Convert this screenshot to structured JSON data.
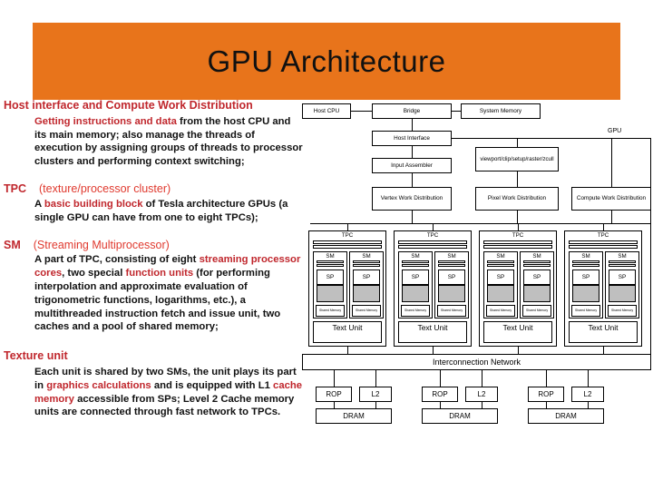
{
  "title": {
    "text": "GPU Architecture",
    "banner_color": "#E8741B"
  },
  "colors": {
    "accent_red": "#C0272D",
    "accent_red_light": "#D13A2A",
    "banner": "#E8741B",
    "gray_block": "#BFBFBF"
  },
  "left_column": {
    "sections": [
      {
        "heading": "Host interface and Compute Work Distribution",
        "heading_suffix": "",
        "body_runs": [
          {
            "t": "Getting instructions and data",
            "red": true
          },
          {
            "t": " from the host CPU and its main memory; also manage the threads of execution by assigning groups of threads to processor clusters and performing context switching;",
            "red": false
          }
        ]
      },
      {
        "heading": "TPC",
        "heading_suffix": "(texture/processor cluster)",
        "body_runs": [
          {
            "t": "A ",
            "red": false
          },
          {
            "t": "basic building block",
            "red": true
          },
          {
            "t": " of Tesla architecture GPUs (a single GPU can have from one to eight TPCs);",
            "red": false
          }
        ]
      },
      {
        "heading": "SM",
        "heading_suffix": "(Streaming Multiprocessor)",
        "body_runs": [
          {
            "t": "A part of TPC, consisting of eight ",
            "red": false
          },
          {
            "t": "streaming processor cores",
            "red": true
          },
          {
            "t": ", two special ",
            "red": false
          },
          {
            "t": "function units",
            "red": true
          },
          {
            "t": " (for performing interpolation and approximate evaluation of trigonometric functions, logarithms, etc.), a multithreaded instruction fetch and issue unit, two caches and a pool of shared memory;",
            "red": false
          }
        ]
      },
      {
        "heading": "Texture unit",
        "heading_suffix": "",
        "body_runs": [
          {
            "t": "Each unit is shared by two SMs, the unit plays its part in ",
            "red": false
          },
          {
            "t": "graphics calculations",
            "red": true
          },
          {
            "t": " and is equipped with L1 ",
            "red": false
          },
          {
            "t": "cache memory",
            "red": true
          },
          {
            "t": " accessible from SPs; Level 2 Cache memory units  are  connected through fast network to TPCs.",
            "red": false
          }
        ]
      }
    ]
  },
  "diagram": {
    "gpu_label": "GPU",
    "host_cpu": "Host CPU",
    "bridge": "Bridge",
    "system_memory": "System Memory",
    "host_interface": "Host Interface",
    "input_assembler": "Input Assembler",
    "viewport": "viewport/clip/setup/raster/zcull",
    "vertex_work": "Vertex Work Distribution",
    "pixel_work": "Pixel Work Distribution",
    "compute_work": "Compute Work Distribution",
    "interconnect": "Interconnection Network",
    "tpc_label": "TPC",
    "sm_label": "SM",
    "sp_label": "SP",
    "shared_memory_label": "Shared Memory",
    "text_unit": "Text Unit",
    "rop": "ROP",
    "l2": "L2",
    "dram": "DRAM",
    "tpc_count": 4,
    "memory_partition_count": 3
  }
}
